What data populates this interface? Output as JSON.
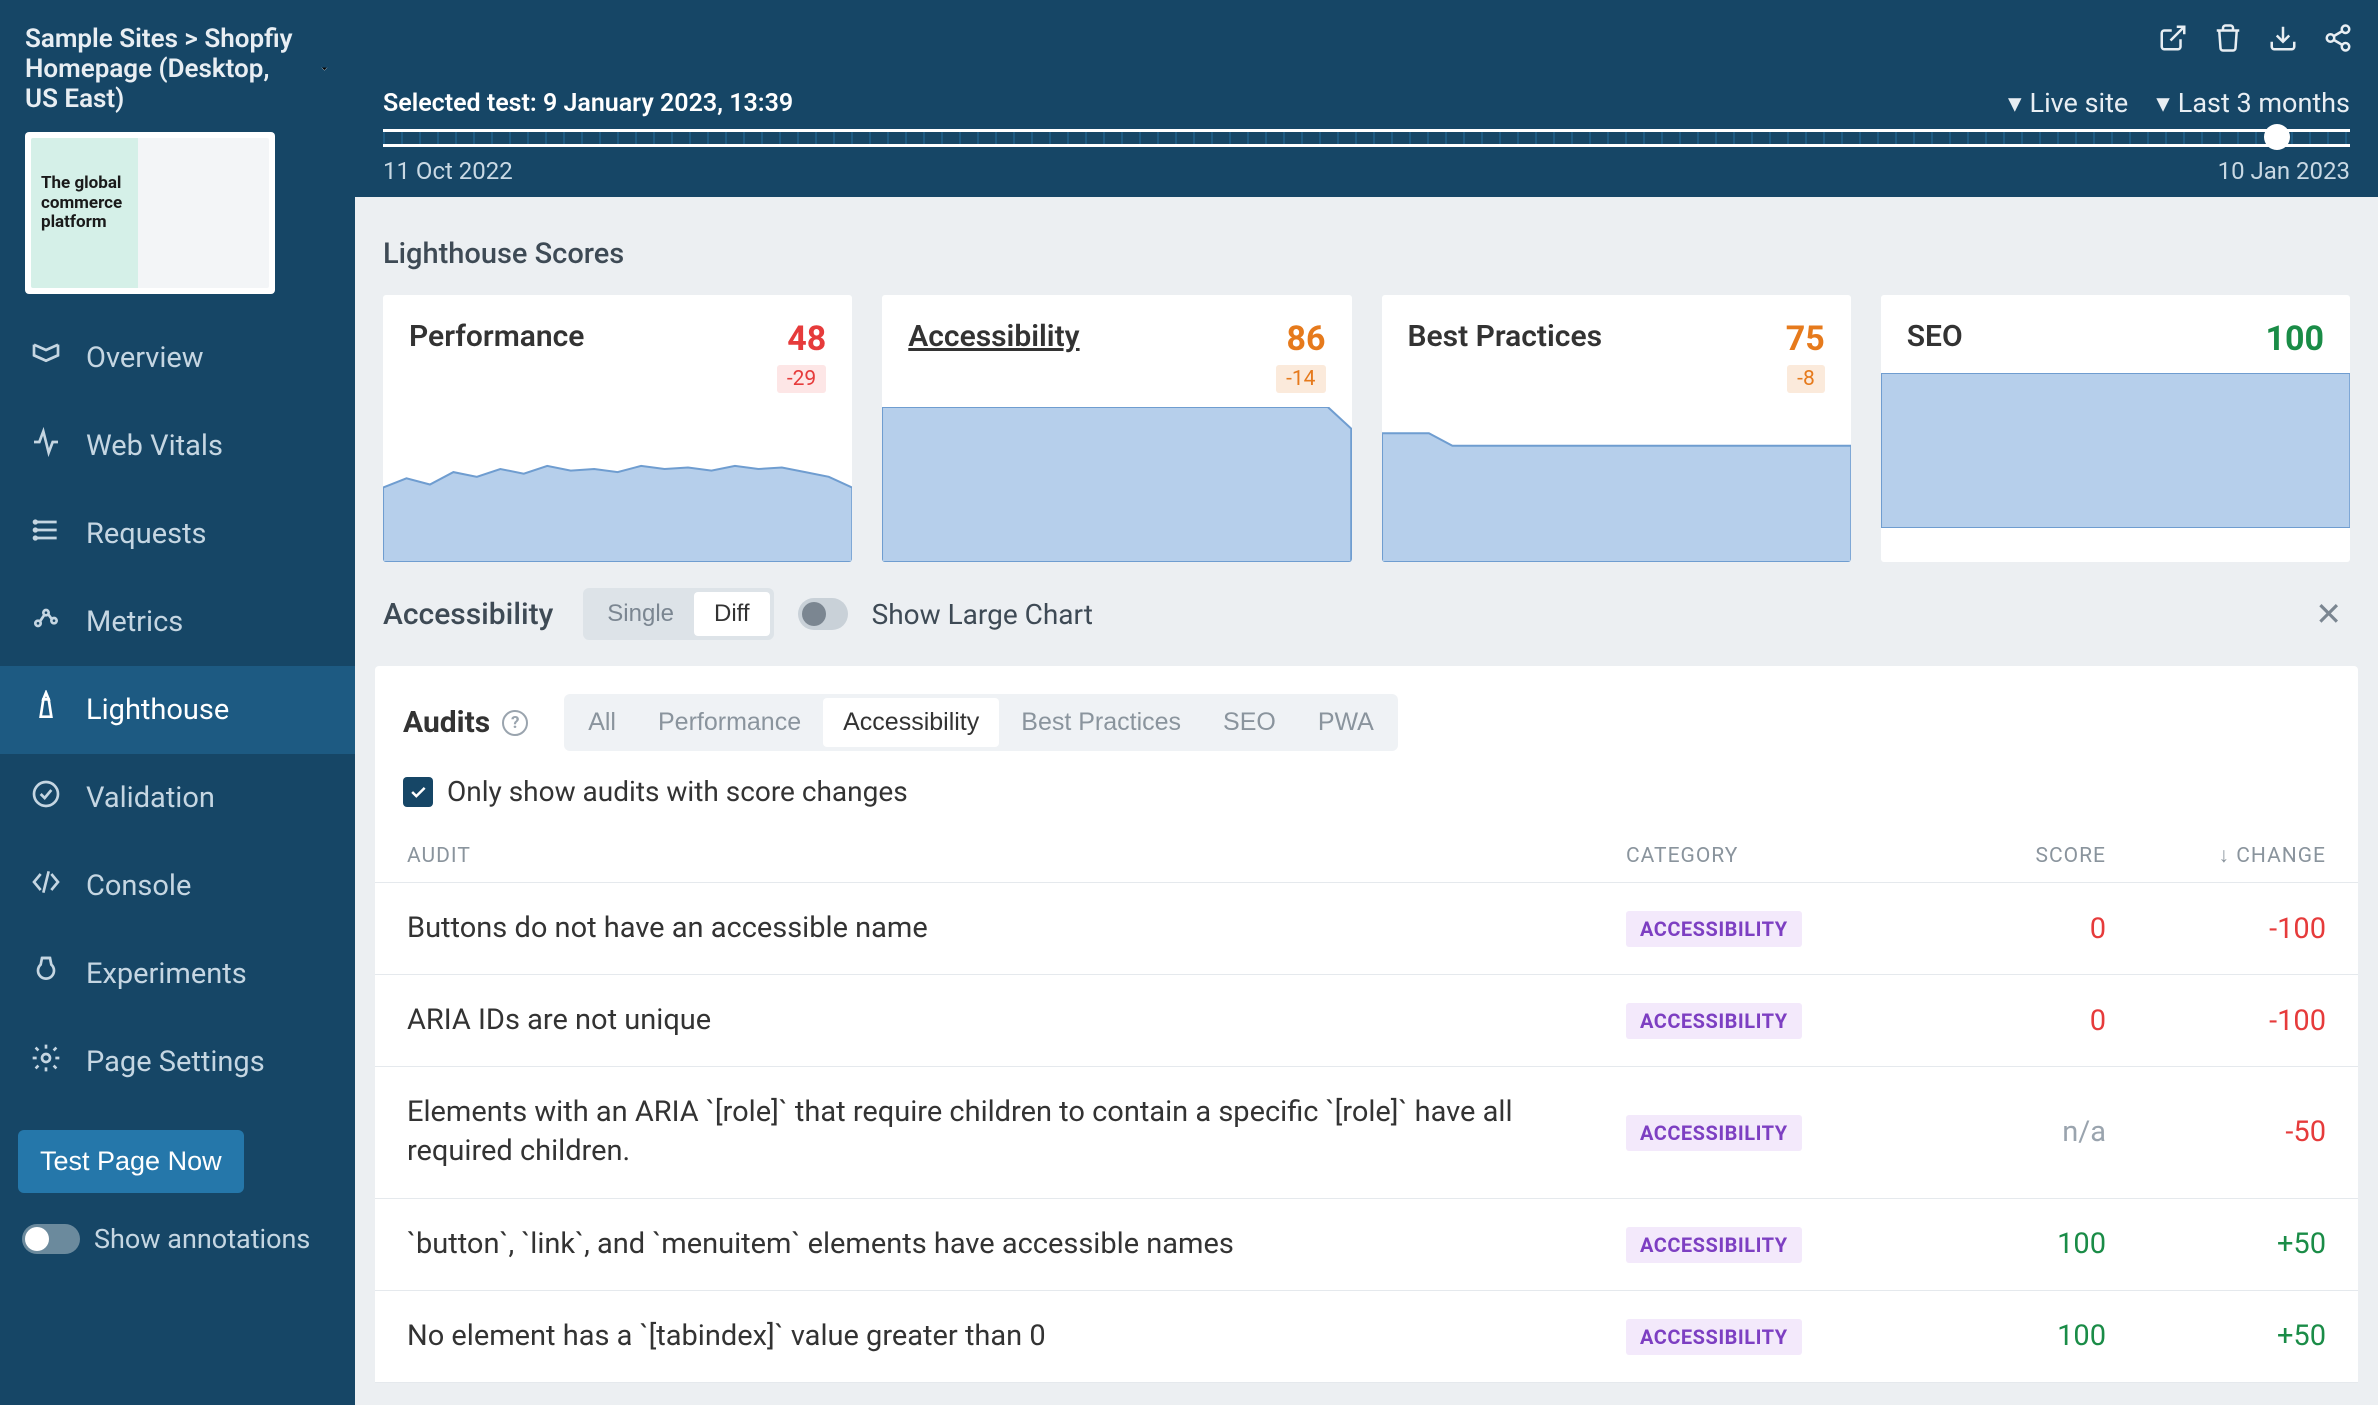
{
  "breadcrumb": "Sample Sites > Shopfiy Homepage (Desktop, US East)",
  "preview": {
    "headline": "The global\ncommerce\nplatform"
  },
  "sidebar": {
    "items": [
      {
        "label": "Overview"
      },
      {
        "label": "Web Vitals"
      },
      {
        "label": "Requests"
      },
      {
        "label": "Metrics"
      },
      {
        "label": "Lighthouse"
      },
      {
        "label": "Validation"
      },
      {
        "label": "Console"
      },
      {
        "label": "Experiments"
      },
      {
        "label": "Page Settings"
      }
    ],
    "test_button": "Test Page Now",
    "annotations_label": "Show annotations"
  },
  "timeline": {
    "selected_label": "Selected test: 9 January 2023, 13:39",
    "start_date": "11 Oct 2022",
    "end_date": "10 Jan 2023",
    "live_site": "Live site",
    "range": "Last 3 months"
  },
  "lighthouse": {
    "section_title": "Lighthouse Scores",
    "cards": [
      {
        "label": "Performance",
        "score": "48",
        "delta": "-29",
        "tone": "bad"
      },
      {
        "label": "Accessibility",
        "score": "86",
        "delta": "-14",
        "tone": "orange",
        "active": true
      },
      {
        "label": "Best Practices",
        "score": "75",
        "delta": "-8",
        "tone": "orange"
      },
      {
        "label": "SEO",
        "score": "100",
        "delta": "",
        "tone": "good"
      }
    ]
  },
  "chart_controls": {
    "title": "Accessibility",
    "seg": {
      "single": "Single",
      "diff": "Diff"
    },
    "large_chart_label": "Show Large Chart"
  },
  "audits": {
    "title": "Audits",
    "tabs": [
      "All",
      "Performance",
      "Accessibility",
      "Best Practices",
      "SEO",
      "PWA"
    ],
    "active_tab": "Accessibility",
    "checkbox_label": "Only show audits with score changes",
    "headers": {
      "audit": "AUDIT",
      "category": "CATEGORY",
      "score": "SCORE",
      "change": "↓ CHANGE"
    },
    "rows": [
      {
        "name": "Buttons do not have an accessible name",
        "category": "ACCESSIBILITY",
        "score": "0",
        "change": "-100",
        "score_tone": "bad",
        "change_tone": "bad"
      },
      {
        "name": "ARIA IDs are not unique",
        "category": "ACCESSIBILITY",
        "score": "0",
        "change": "-100",
        "score_tone": "bad",
        "change_tone": "bad"
      },
      {
        "name": "Elements with an ARIA `[role]` that require children to contain a specific `[role]` have all required children.",
        "category": "ACCESSIBILITY",
        "score": "n/a",
        "change": "-50",
        "score_tone": "gray",
        "change_tone": "bad"
      },
      {
        "name": "`button`, `link`, and `menuitem` elements have accessible names",
        "category": "ACCESSIBILITY",
        "score": "100",
        "change": "+50",
        "score_tone": "good",
        "change_tone": "good"
      },
      {
        "name": "No element has a `[tabindex]` value greater than 0",
        "category": "ACCESSIBILITY",
        "score": "100",
        "change": "+50",
        "score_tone": "good",
        "change_tone": "good"
      }
    ]
  },
  "chart_data": [
    {
      "type": "area",
      "title": "Performance",
      "ylim": [
        0,
        100
      ],
      "x_range": [
        "11 Oct 2022",
        "10 Jan 2023"
      ],
      "values": [
        48,
        54,
        50,
        58,
        55,
        60,
        57,
        62,
        59,
        60,
        58,
        62,
        60,
        61,
        59,
        62,
        60,
        61,
        58,
        55,
        48
      ]
    },
    {
      "type": "area",
      "title": "Accessibility",
      "ylim": [
        0,
        100
      ],
      "x_range": [
        "11 Oct 2022",
        "10 Jan 2023"
      ],
      "values": [
        100,
        100,
        100,
        100,
        100,
        100,
        100,
        100,
        100,
        100,
        100,
        100,
        100,
        100,
        100,
        100,
        100,
        100,
        100,
        100,
        86
      ]
    },
    {
      "type": "area",
      "title": "Best Practices",
      "ylim": [
        0,
        100
      ],
      "x_range": [
        "11 Oct 2022",
        "10 Jan 2023"
      ],
      "values": [
        83,
        83,
        83,
        75,
        75,
        75,
        75,
        75,
        75,
        75,
        75,
        75,
        75,
        75,
        75,
        75,
        75,
        75,
        75,
        75,
        75
      ]
    },
    {
      "type": "area",
      "title": "SEO",
      "ylim": [
        0,
        100
      ],
      "x_range": [
        "11 Oct 2022",
        "10 Jan 2023"
      ],
      "values": [
        100,
        100,
        100,
        100,
        100,
        100,
        100,
        100,
        100,
        100,
        100,
        100,
        100,
        100,
        100,
        100,
        100,
        100,
        100,
        100,
        100
      ]
    }
  ]
}
